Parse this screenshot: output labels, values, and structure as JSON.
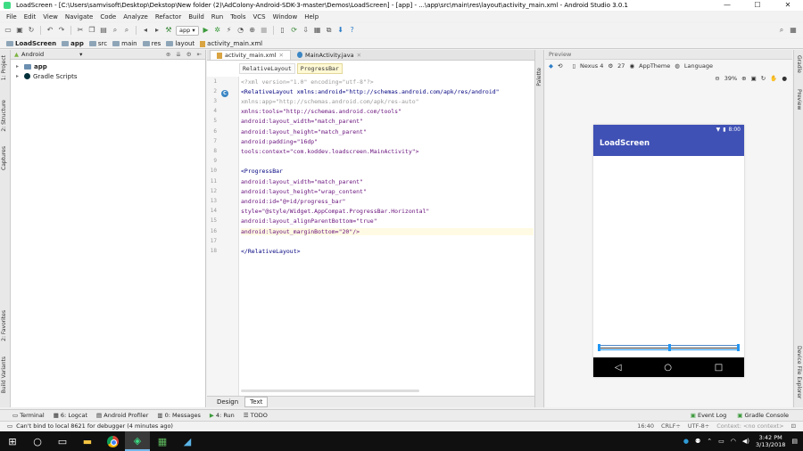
{
  "window": {
    "title": "LoadScreen - [C:\\Users\\samvisoft\\Desktop\\Dekstop\\New folder (2)\\AdColony-Android-SDK-3-master\\Demos\\LoadScreen] - [app] - ...\\app\\src\\main\\res\\layout\\activity_main.xml - Android Studio 3.0.1",
    "minimize": "—",
    "maximize": "☐",
    "close": "✕"
  },
  "menu": [
    "File",
    "Edit",
    "View",
    "Navigate",
    "Code",
    "Analyze",
    "Refactor",
    "Build",
    "Run",
    "Tools",
    "VCS",
    "Window",
    "Help"
  ],
  "toolbar": {
    "run_config": "app"
  },
  "breadcrumbs": [
    "LoadScreen",
    "app",
    "src",
    "main",
    "res",
    "layout",
    "activity_main.xml"
  ],
  "project": {
    "view_mode": "Android",
    "items": [
      {
        "label": "app",
        "bold": true
      },
      {
        "label": "Gradle Scripts",
        "bold": false
      }
    ]
  },
  "left_tabs": [
    "1: Project",
    "2: Structure",
    "Captures",
    "2: Favorites",
    "Build Variants"
  ],
  "editor": {
    "tabs": [
      "activity_main.xml",
      "MainActivity.java"
    ],
    "xml_crumbs": [
      "RelativeLayout",
      "ProgressBar"
    ],
    "line_numbers": [
      "1",
      "2",
      "3",
      "4",
      "5",
      "6",
      "7",
      "8",
      "9",
      "10",
      "11",
      "12",
      "13",
      "14",
      "15",
      "16",
      "17",
      "18"
    ],
    "lines": [
      "<?xml version=\"1.0\" encoding=\"utf-8\"?>",
      "<RelativeLayout xmlns:android=\"http://schemas.android.com/apk/res/android\"",
      "    xmlns:app=\"http://schemas.android.com/apk/res-auto\"",
      "    xmlns:tools=\"http://schemas.android.com/tools\"",
      "    android:layout_width=\"match_parent\"",
      "    android:layout_height=\"match_parent\"",
      "    android:padding=\"16dp\"",
      "    tools:context=\"com.koddev.loadscreen.MainActivity\">",
      "",
      "    <ProgressBar",
      "        android:layout_width=\"match_parent\"",
      "        android:layout_height=\"wrap_content\"",
      "        android:id=\"@+id/progress_bar\"",
      "        style=\"@style/Widget.AppCompat.ProgressBar.Horizontal\"",
      "        android:layout_alignParentBottom=\"true\"",
      "        android:layout_marginBottom=\"20\"/>",
      "",
      "</RelativeLayout>"
    ],
    "bottom_tabs": [
      "Design",
      "Text"
    ]
  },
  "palette_label": "Palette",
  "preview": {
    "header": "Preview",
    "device": "Nexus 4",
    "api": "27",
    "theme": "AppTheme",
    "language": "Language",
    "zoom": "39%",
    "phone_time": "8:00",
    "app_title": "LoadScreen"
  },
  "right_tabs": [
    "Gradle",
    "Preview",
    "Device File Explorer"
  ],
  "bottom_tools": [
    "Terminal",
    "6: Logcat",
    "Android Profiler",
    "0: Messages",
    "4: Run",
    "TODO"
  ],
  "bottom_tools_right": [
    "Event Log",
    "Gradle Console"
  ],
  "status": {
    "message": "Can't bind to local 8621 for debugger (4 minutes ago)",
    "position": "16:40",
    "line_sep": "CRLF÷",
    "encoding": "UTF-8÷",
    "context": "Context: <no context>"
  },
  "taskbar": {
    "time": "3:42 PM",
    "date": "3/13/2018"
  }
}
